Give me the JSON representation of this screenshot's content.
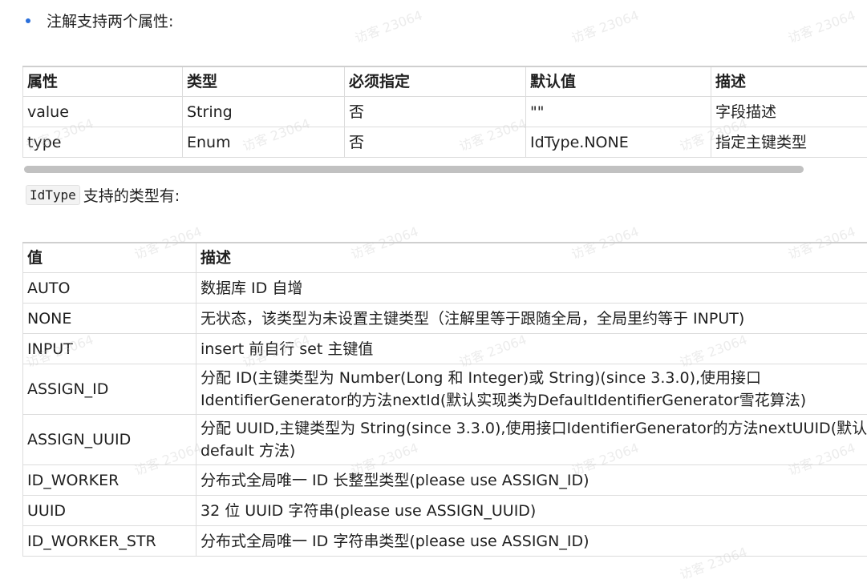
{
  "intro_text": "注解支持两个属性:",
  "attr_table": {
    "headers": [
      "属性",
      "类型",
      "必须指定",
      "默认值",
      "描述"
    ],
    "rows": [
      [
        "value",
        "String",
        "否",
        "\"\"",
        "字段描述"
      ],
      [
        "type",
        "Enum",
        "否",
        "IdType.NONE",
        "指定主键类型"
      ]
    ]
  },
  "idtype_line": {
    "code": "IdType",
    "text": "支持的类型有:"
  },
  "type_table": {
    "headers": [
      "值",
      "描述"
    ],
    "rows": [
      [
        "AUTO",
        "数据库 ID 自增"
      ],
      [
        "NONE",
        "无状态，该类型为未设置主键类型（注解里等于跟随全局，全局里约等于 INPUT)"
      ],
      [
        "INPUT",
        "insert 前自行 set 主键值"
      ],
      [
        "ASSIGN_ID",
        "分配 ID(主键类型为 Number(Long 和 Integer)或 String)(since 3.3.0),使用接口IdentifierGenerator的方法nextId(默认实现类为DefaultIdentifierGenerator雪花算法)"
      ],
      [
        "ASSIGN_UUID",
        "分配 UUID,主键类型为 String(since 3.3.0),使用接口IdentifierGenerator的方法nextUUID(默认default 方法)"
      ],
      [
        "ID_WORKER",
        "分布式全局唯一 ID 长整型类型(please use ASSIGN_ID)"
      ],
      [
        "UUID",
        "32 位 UUID 字符串(please use ASSIGN_UUID)"
      ],
      [
        "ID_WORKER_STR",
        "分布式全局唯一 ID 字符串类型(please use ASSIGN_ID)"
      ]
    ]
  },
  "watermark": "访客 23064"
}
